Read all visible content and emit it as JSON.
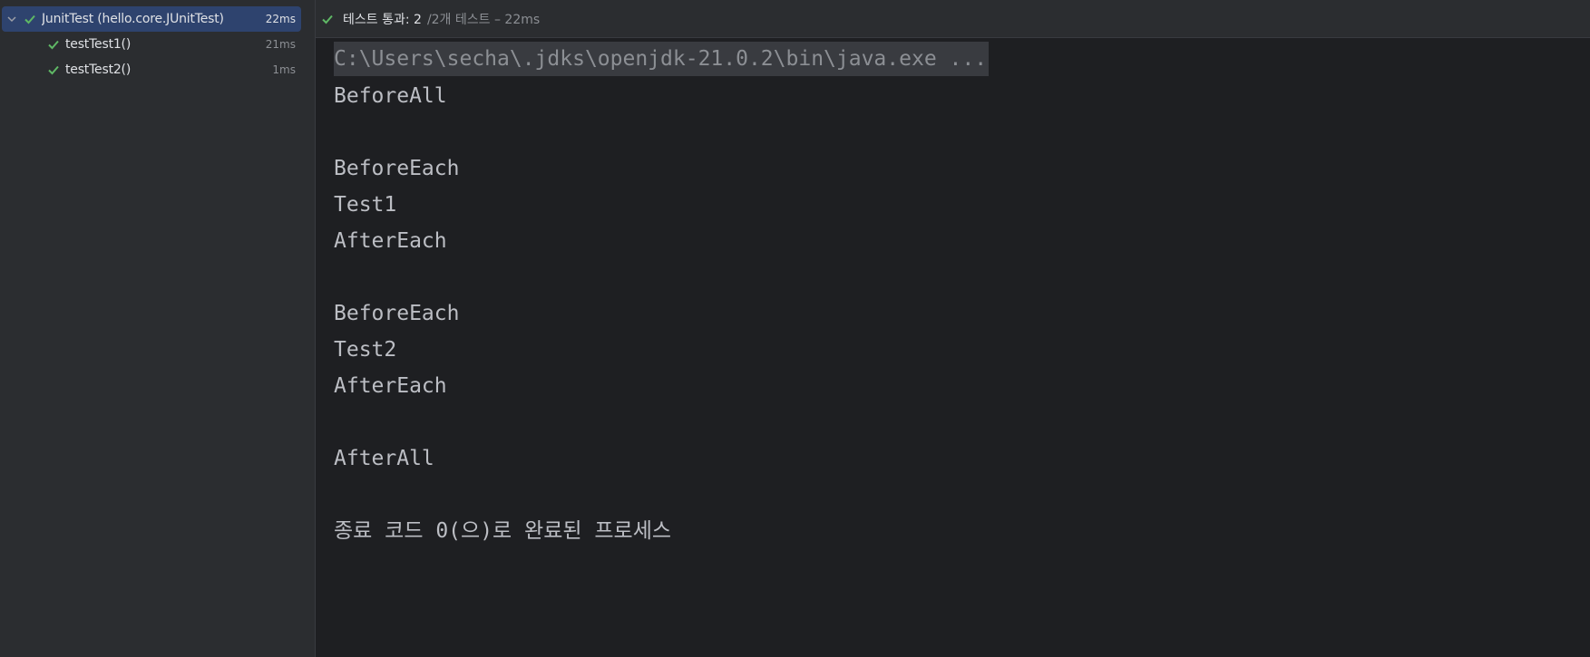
{
  "colors": {
    "pass_green": "#5fb865",
    "selection": "#2e436e"
  },
  "tree": {
    "root": {
      "label": "JunitTest (hello.core.JUnitTest)",
      "time": "22ms",
      "icon": "check-icon"
    },
    "children": [
      {
        "label": "testTest1()",
        "time": "21ms",
        "icon": "check-icon"
      },
      {
        "label": "testTest2()",
        "time": "1ms",
        "icon": "check-icon"
      }
    ]
  },
  "status": {
    "passed": "테스트 통과: 2",
    "detail": "/2개 테스트 – 22ms"
  },
  "console": {
    "command": "C:\\Users\\secha\\.jdks\\openjdk-21.0.2\\bin\\java.exe ...",
    "lines": [
      "BeforeAll",
      "",
      "BeforeEach",
      "Test1",
      "AfterEach",
      "",
      "BeforeEach",
      "Test2",
      "AfterEach",
      "",
      "AfterAll",
      "",
      "종료 코드 0(으)로 완료된 프로세스"
    ]
  }
}
